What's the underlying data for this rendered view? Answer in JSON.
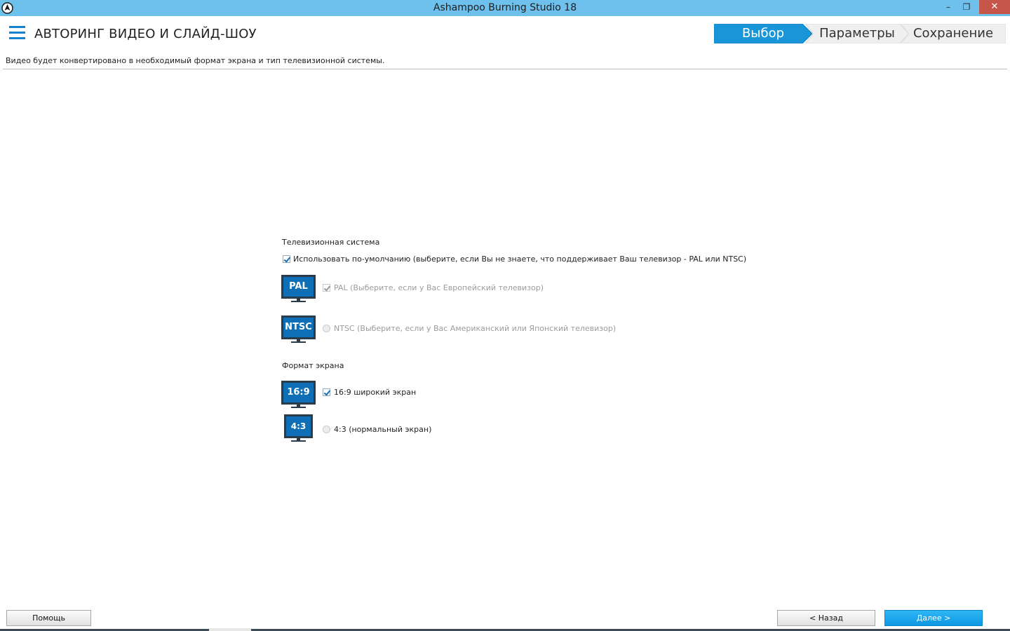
{
  "window": {
    "title": "Ashampoo Burning Studio 18",
    "controls": {
      "minimize": "–",
      "maximize": "❐",
      "close": "✕"
    },
    "accent_color": "#6ec1ec"
  },
  "header": {
    "title": "АВТОРИНГ ВИДЕО И СЛАЙД-ШОУ",
    "menu_icon": "hamburger-icon",
    "steps": [
      {
        "label": "Выбор",
        "active": true
      },
      {
        "label": "Параметры",
        "active": false
      },
      {
        "label": "Сохранение",
        "active": false
      }
    ],
    "active_step_color": "#1a96d8"
  },
  "hint": "Видео будет конвертировано в необходимый формат экрана и тип телевизионной системы.",
  "tv_system": {
    "label": "Телевизионная система",
    "use_default": {
      "label": "Использовать по-умолчанию (выберите, если Вы не знаете, что поддерживает Ваш телевизор - PAL или NTSC)",
      "checked": true
    },
    "pal": {
      "badge": "PAL",
      "label": "PAL (Выберите, если у Вас Европейский телевизор)",
      "checked": true,
      "disabled": true
    },
    "ntsc": {
      "badge": "NTSC",
      "label": "NTSC (Выберите, если у Вас Американский или Японский телевизор)",
      "checked": false,
      "disabled": true
    }
  },
  "screen_format": {
    "label": "Формат экрана",
    "wide": {
      "badge": "16:9",
      "label": "16:9 широкий экран",
      "checked": true
    },
    "normal": {
      "badge": "4:3",
      "label": "4:3 (нормальный экран)",
      "checked": false
    }
  },
  "buttons": {
    "help": "Помощь",
    "back": "< Назад",
    "next": "Далее >"
  }
}
